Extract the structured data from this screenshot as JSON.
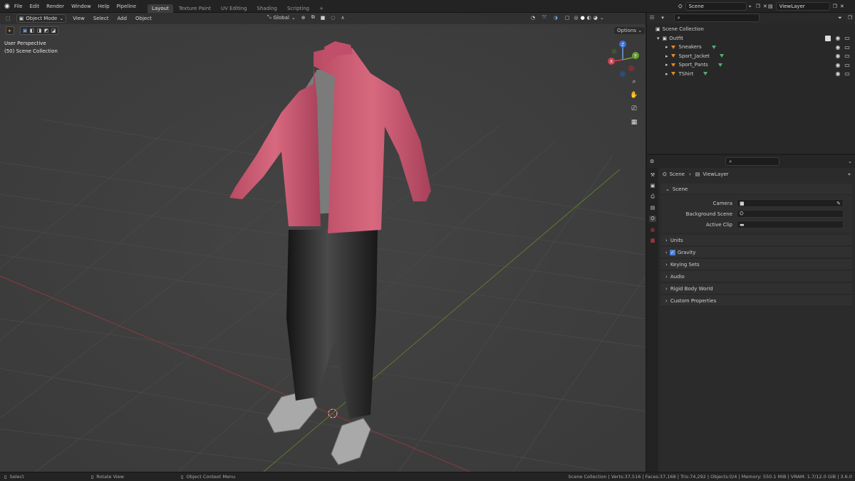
{
  "topbar": {
    "menus": [
      "File",
      "Edit",
      "Render",
      "Window",
      "Help",
      "Pipeline"
    ],
    "workspaces": [
      "Layout",
      "Texture Paint",
      "UV Editing",
      "Shading",
      "Scripting"
    ],
    "active_workspace": "Layout",
    "add_tab": "+",
    "scene_name": "Scene",
    "view_layer_name": "ViewLayer"
  },
  "viewport": {
    "mode": "Object Mode",
    "menus": [
      "View",
      "Select",
      "Add",
      "Object"
    ],
    "orientation": "Global",
    "options_label": "Options",
    "overlay_title": "User Perspective",
    "overlay_subtitle": "(50) Scene Collection",
    "gizmo": {
      "x": "X",
      "y": "Y",
      "z": "Z"
    }
  },
  "outliner": {
    "root": "Scene Collection",
    "collection": "Outfit",
    "objects": [
      "Sneakers",
      "Sport_Jacket",
      "Sport_Pants",
      "TShirt"
    ]
  },
  "properties": {
    "breadcrumb_scene": "Scene",
    "breadcrumb_viewlayer": "ViewLayer",
    "scene_panel": "Scene",
    "fields": [
      {
        "label": "Camera",
        "value": ""
      },
      {
        "label": "Background Scene",
        "value": ""
      },
      {
        "label": "Active Clip",
        "value": ""
      }
    ],
    "panels": [
      "Units",
      "Gravity",
      "Keying Sets",
      "Audio",
      "Rigid Body World",
      "Custom Properties"
    ]
  },
  "statusbar": {
    "select": "Select",
    "rotate": "Rotate View",
    "context": "Object Context Menu",
    "stats": "Scene Collection | Verts:37,516 | Faces:37,168 | Tris:74,292 | Objects:0/4 | Memory: 550.1 MiB | VRAM: 1.7/12.0 GiB | 3.6.0"
  }
}
